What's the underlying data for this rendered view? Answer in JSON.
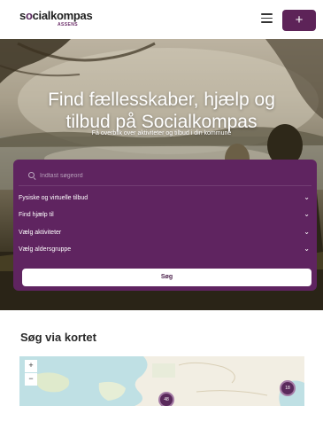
{
  "header": {
    "logo_text_pre": "s",
    "logo_text_o": "o",
    "logo_text_post": "cialkompas",
    "logo_sub": "ASSENS",
    "add_label": "+"
  },
  "hero": {
    "title": "Find fællesskaber, hjælp og tilbud på Socialkompas",
    "subtitle": "Få overblik over aktiviteter og tilbud i din kommune"
  },
  "search": {
    "placeholder": "Indtast søgeord",
    "dropdowns": [
      {
        "label": "Fysiske og virtuelle tilbud"
      },
      {
        "label": "Find hjælp til"
      },
      {
        "label": "Vælg aktiviteter"
      },
      {
        "label": "Vælg aldersgruppe"
      }
    ],
    "button_label": "Søg"
  },
  "map_section": {
    "title": "Søg via kortet",
    "zoom_in": "+",
    "zoom_out": "−",
    "clusters": [
      {
        "count": "48"
      },
      {
        "count": "18"
      }
    ]
  },
  "colors": {
    "brand": "#5d2358",
    "panel": "#5f2460"
  }
}
